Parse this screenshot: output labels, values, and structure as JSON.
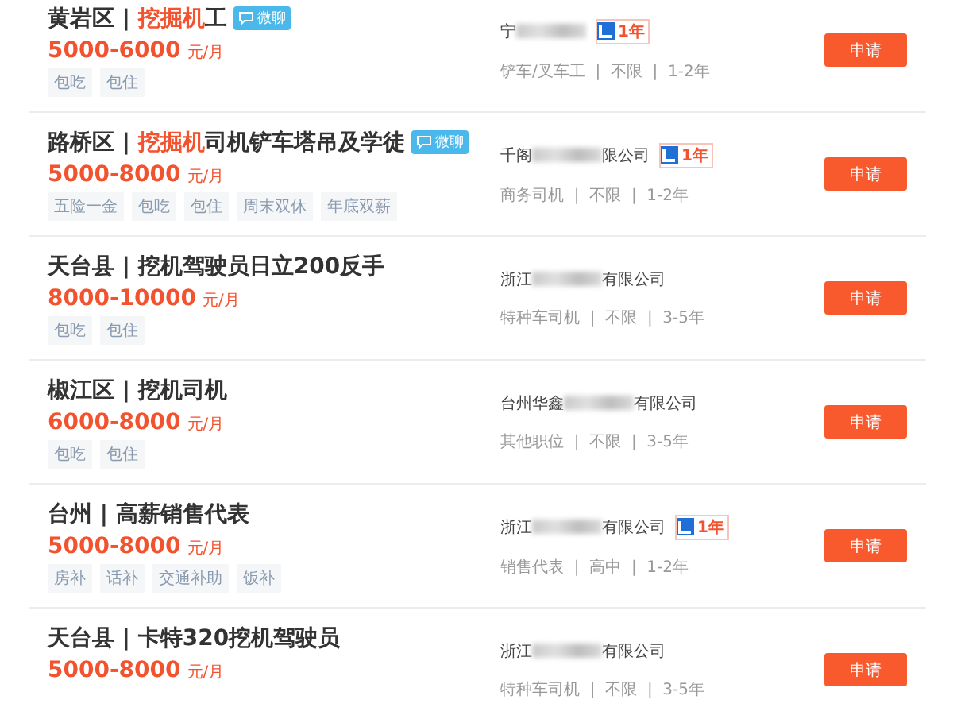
{
  "jobs": [
    {
      "title": [
        {
          "text": "黄岩区 | ",
          "highlight": false
        },
        {
          "text": "挖掘机",
          "highlight": true
        },
        {
          "text": "工",
          "highlight": false
        }
      ],
      "chat_badge": "微聊",
      "salary": "5000-6000",
      "unit": "元/月",
      "tags": [
        "包吃",
        "包住"
      ],
      "company_start": "宁",
      "years_badge": "1年",
      "meta": "铲车/叉车工  |  不限  |  1-2年",
      "apply": "申请"
    },
    {
      "title": [
        {
          "text": "路桥区 | ",
          "highlight": false
        },
        {
          "text": "挖掘机",
          "highlight": true
        },
        {
          "text": "司机铲车塔吊及学徒",
          "highlight": false
        }
      ],
      "chat_badge": "微聊",
      "salary": "5000-8000",
      "unit": "元/月",
      "tags": [
        "五险一金",
        "包吃",
        "包住",
        "周末双休",
        "年底双薪"
      ],
      "company_start": "千阁",
      "company_end": "限公司",
      "years_badge": "1年",
      "meta": "商务司机  |  不限  |  1-2年",
      "apply": "申请"
    },
    {
      "title": [
        {
          "text": "天台县 | 挖机驾驶员日立200反手",
          "highlight": false
        }
      ],
      "salary": "8000-10000",
      "unit": "元/月",
      "tags": [
        "包吃",
        "包住"
      ],
      "company_start": "浙江",
      "company_end": "有限公司",
      "meta": "特种车司机  |  不限  |  3-5年",
      "apply": "申请"
    },
    {
      "title": [
        {
          "text": "椒江区 | 挖机司机",
          "highlight": false
        }
      ],
      "salary": "6000-8000",
      "unit": "元/月",
      "tags": [
        "包吃",
        "包住"
      ],
      "company_start": "台州华鑫",
      "company_end": "有限公司",
      "meta": "其他职位  |  不限  |  3-5年",
      "apply": "申请"
    },
    {
      "title": [
        {
          "text": "台州 | 高薪销售代表",
          "highlight": false
        }
      ],
      "salary": "5000-8000",
      "unit": "元/月",
      "tags": [
        "房补",
        "话补",
        "交通补助",
        "饭补"
      ],
      "company_start": "浙江",
      "company_end": "有限公司",
      "years_badge": "1年",
      "meta": "销售代表  |  高中  |  1-2年",
      "apply": "申请"
    },
    {
      "title": [
        {
          "text": "天台县 | 卡特320挖机驾驶员",
          "highlight": false
        }
      ],
      "salary": "5000-8000",
      "unit": "元/月",
      "company_start": "浙江",
      "company_end": "有限公司",
      "meta": "特种车司机  |  不限  |  3-5年",
      "apply": "申请"
    }
  ]
}
